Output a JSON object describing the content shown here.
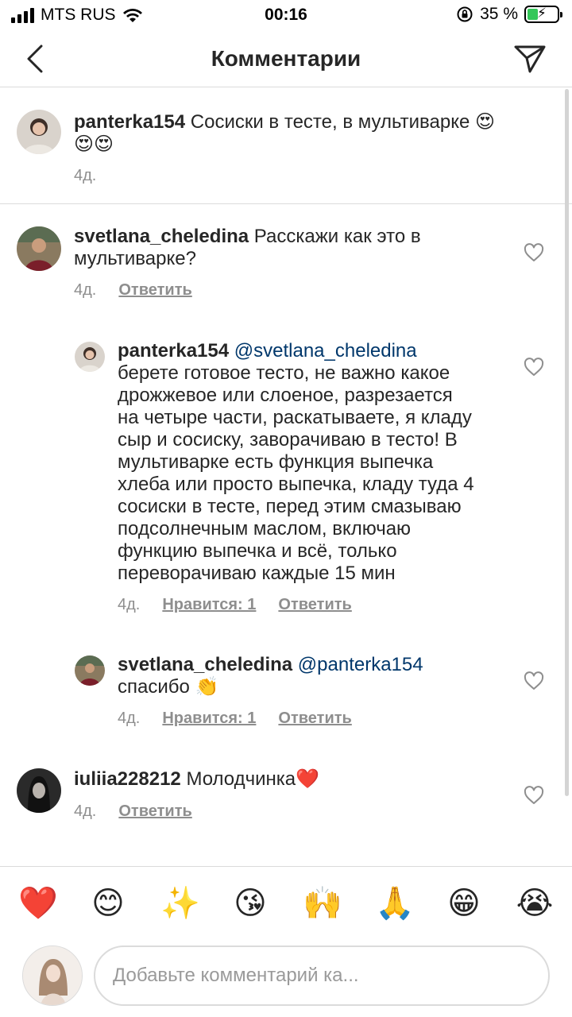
{
  "status_bar": {
    "carrier": "MTS RUS",
    "time": "00:16",
    "battery_percent": "35 %",
    "battery_level": 0.35
  },
  "header": {
    "title": "Комментарии"
  },
  "caption": {
    "username": "panterka154",
    "text": "Сосиски в тесте, в мультиварке 😍",
    "text2": "😍😍",
    "time": "4д."
  },
  "comments": [
    {
      "username": "svetlana_cheledina",
      "text": "Расскажи как это в",
      "text2": "мультиварке?",
      "time": "4д.",
      "reply_label": "Ответить"
    },
    {
      "username": "panterka154",
      "mention": "@svetlana_cheledina",
      "lines": [
        "берете готовое тесто, не важно какое",
        "дрожжевое или слоеное, разрезается",
        "на четыре части, раскатываете, я кладу",
        "сыр и сосиску, заворачиваю в тесто! В",
        "мультиварке есть функция выпечка",
        "хлеба или просто выпечка, кладу туда 4",
        "сосиски в тесте, перед этим смазываю",
        "подсолнечным маслом, включаю",
        "функцию выпечка и всё, только",
        "переворачиваю каждые 15 мин"
      ],
      "time": "4д.",
      "likes_label": "Нравится: 1",
      "reply_label": "Ответить"
    },
    {
      "username": "svetlana_cheledina",
      "mention": "@panterka154",
      "text": "спасибо 👏",
      "time": "4д.",
      "likes_label": "Нравится: 1",
      "reply_label": "Ответить"
    },
    {
      "username": "iuliia228212",
      "text": "Молодчинка❤️",
      "time": "4д.",
      "reply_label": "Ответить"
    }
  ],
  "emoji_bar": [
    "❤️",
    "😊",
    "✨",
    "😘",
    "🙌",
    "🙏",
    "😁",
    "😭"
  ],
  "composer": {
    "placeholder": "Добавьте комментарий ка..."
  },
  "colors": {
    "text": "#262626",
    "meta": "#8e8e8e",
    "mention": "#00376b",
    "divider": "#dbdbdb",
    "battery": "#34c759"
  }
}
